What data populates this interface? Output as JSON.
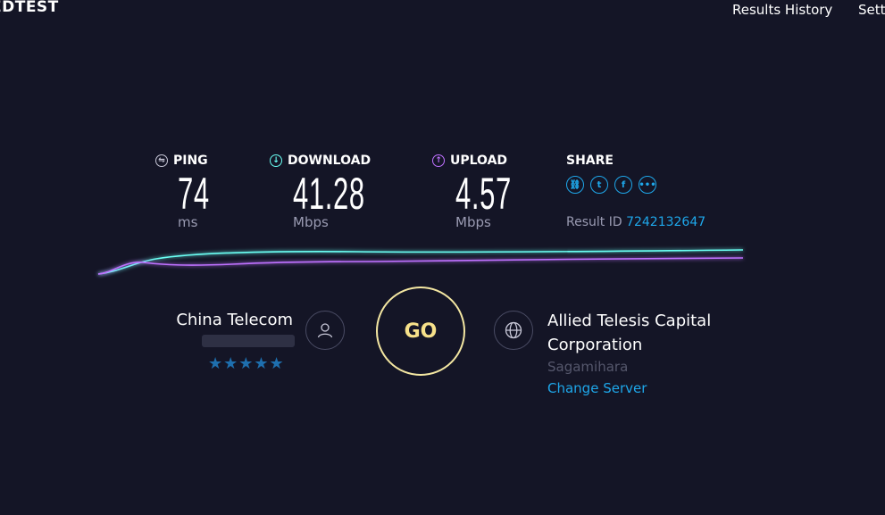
{
  "header": {
    "logo_text": "EDTEST",
    "nav": [
      {
        "label": "Results History"
      },
      {
        "label": "Sett"
      }
    ]
  },
  "metrics": {
    "ping": {
      "label": "PING",
      "value": "74",
      "unit": "ms",
      "icon": "ping-icon",
      "color": "#c8c8d8"
    },
    "download": {
      "label": "DOWNLOAD",
      "value": "41.28",
      "unit": "Mbps",
      "icon": "download-arrow-icon",
      "color": "#6afff3"
    },
    "upload": {
      "label": "UPLOAD",
      "value": "4.57",
      "unit": "Mbps",
      "icon": "upload-arrow-icon",
      "color": "#bf71ff"
    }
  },
  "share": {
    "label": "SHARE",
    "icons": [
      "link-icon",
      "twitter-icon",
      "facebook-icon",
      "more-icon"
    ],
    "result_label": "Result ID",
    "result_id": "7242132647"
  },
  "isp": {
    "name": "China Telecom",
    "rating_stars": 5,
    "stars_text": "★★★★★",
    "icon": "user-icon"
  },
  "go_button": {
    "label": "GO",
    "color": "#f7e18a"
  },
  "server": {
    "icon": "globe-icon",
    "name": "Allied Telesis Capital Corporation",
    "location": "Sagamihara",
    "change_label": "Change Server"
  },
  "colors": {
    "background": "#141526",
    "accent": "#1ea7ea",
    "download_line": "#6afff3",
    "upload_line": "#bf71ff"
  }
}
